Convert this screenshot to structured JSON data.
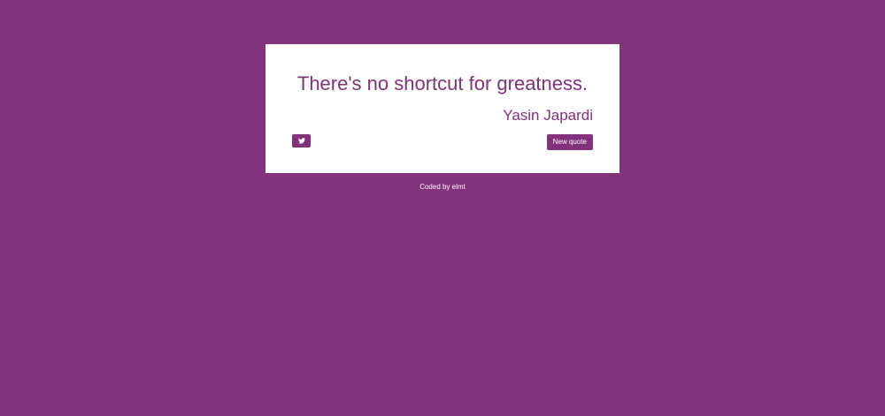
{
  "colors": {
    "background": "#82317b",
    "card": "#ffffff",
    "accent": "#82317b",
    "button_text": "#ffffff"
  },
  "quote": {
    "text": "There's no shortcut for greatness.",
    "author": "Yasin Japardi"
  },
  "actions": {
    "tweet_icon": "twitter-icon",
    "new_quote_label": "New quote"
  },
  "footer": {
    "credit": "Coded by elmt"
  }
}
